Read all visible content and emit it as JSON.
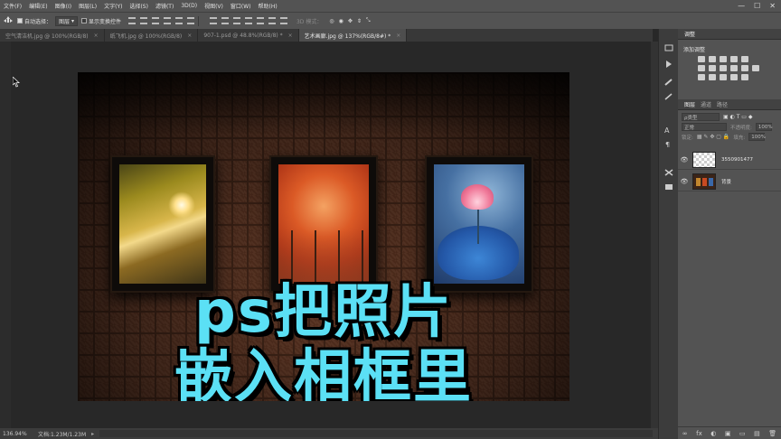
{
  "menu": [
    "文件(F)",
    "编辑(E)",
    "图像(I)",
    "图层(L)",
    "文字(Y)",
    "选择(S)",
    "滤镜(T)",
    "3D(D)",
    "视图(V)",
    "窗口(W)",
    "帮助(H)"
  ],
  "window_controls": {
    "minimize": "—",
    "maximize": "☐",
    "close": "✕"
  },
  "options": {
    "auto_select_label": "自动选择：",
    "auto_select_value": "图层",
    "transform_label": "显示变换控件",
    "mode_3d": "3D 模式："
  },
  "tabs": [
    {
      "label": "空气清洁机.jpg @ 100%(RGB/8)",
      "close": "×"
    },
    {
      "label": "纸飞机.jpg @ 100%(RGB/8)",
      "close": "×"
    },
    {
      "label": "907-1.psd @ 48.8%(RGB/8) *",
      "close": "×"
    },
    {
      "label": "艺术画廊.jpg @ 137%(RGB/8#) *",
      "close": "×",
      "active": true
    }
  ],
  "canvas": {
    "headline_line1": "ps把照片",
    "headline_line2": "嵌入相框里",
    "headline_color": "#5be0f5"
  },
  "status": {
    "zoom": "136.94%",
    "doc": "文档:1.23M/1.23M",
    "arrow": "▸"
  },
  "panel": {
    "adjust_tab": "调整",
    "add_adjust": "添加调整",
    "layer_tabs": [
      "图层",
      "通道",
      "路径"
    ],
    "filter_kind": "ρ类型",
    "blend_mode": "正常",
    "opacity_label": "不透明度:",
    "opacity_value": "100%",
    "lock_label": "锁定:",
    "fill_label": "填充:",
    "fill_value": "100%",
    "layers": [
      {
        "name": "3550901477",
        "eye": "👁"
      },
      {
        "name": "背景",
        "eye": "👁"
      }
    ],
    "footer_icons": [
      "∞",
      "fx",
      "◐",
      "▣",
      "▭",
      "▤",
      "🗑"
    ]
  }
}
